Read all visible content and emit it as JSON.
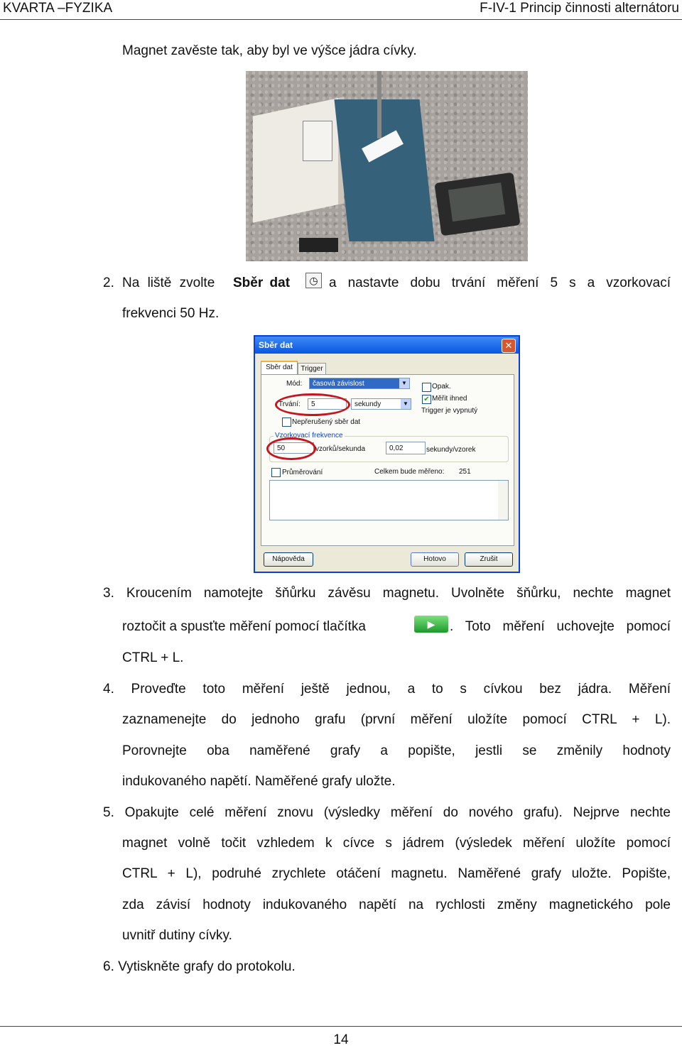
{
  "header": {
    "left": "KVARTA –FYZIKA",
    "right": "F-IV-1 Princip činnosti alternátoru"
  },
  "intro": "Magnet zavěste tak, aby byl ve výšce jádra cívky.",
  "step2": {
    "num": "2.",
    "pre": "Na liště zvolte",
    "bold": "Sběr dat",
    "post": "a nastavte dobu trvání měření 5 s a vzorkovací",
    "line2": "frekvenci 50 Hz.",
    "icon": "data-collection-clock-icon"
  },
  "dialog": {
    "title": "Sběr dat",
    "tabs": [
      "Sběr dat",
      "Trigger"
    ],
    "mode_label": "Mód:",
    "mode_value": "časová závislost",
    "duration_label": "Trvání:",
    "duration_value": "5",
    "duration_unit": "sekundy",
    "repeat": "Opak.",
    "measure_now": "Měřit ihned",
    "trigger_status": "Trigger je vypnutý",
    "continuous": "Nepřerušený sběr dat",
    "freq_group": "Vzorkovací frekvence",
    "rate_value": "50",
    "rate_unit": "vzorků/sekunda",
    "period_value": "0,02",
    "period_unit": "sekundy/vzorek",
    "averaging": "Průměrování",
    "total_label": "Celkem bude měřeno:",
    "total_value": "251",
    "help": "Nápověda",
    "ok": "Hotovo",
    "cancel": "Zrušit",
    "highlight_color": "#c8141c"
  },
  "step3": {
    "l1": "3. Kroucením namotejte šňůrku závěsu magnetu. Uvolněte šňůrku, nechte magnet",
    "l2a": "roztočit a spusťte měření pomocí tlačítka",
    "l2b": ". Toto měření uchovejte pomocí",
    "l3": "CTRL + L.",
    "icon": "play-button-icon"
  },
  "step4": [
    "4. Proveďte toto měření ještě jednou, a to s cívkou bez jádra. Měření",
    "zaznamenejte do jednoho grafu (první měření uložíte pomocí CTRL + L).",
    "Porovnejte oba naměřené grafy a popište, jestli se změnily hodnoty",
    "indukovaného napětí. Naměřené grafy uložte."
  ],
  "step5": [
    "5. Opakujte celé měření znovu (výsledky měření do nového grafu). Nejprve nechte",
    "magnet volně točit vzhledem k cívce s jádrem (výsledek měření uložíte pomocí",
    "CTRL + L), podruhé zrychlete otáčení magnetu. Naměřené grafy uložte. Popište,",
    "zda závisí hodnoty indukovaného napětí na rychlosti změny magnetického pole",
    "uvnitř dutiny cívky."
  ],
  "step6": "6. Vytiskněte grafy do protokolu.",
  "page_number": "14"
}
